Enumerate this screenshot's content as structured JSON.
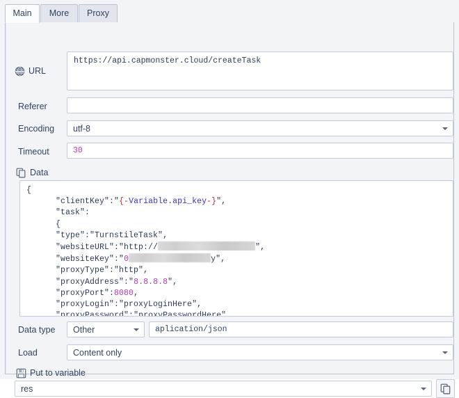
{
  "tabs": [
    {
      "label": "Main",
      "active": true
    },
    {
      "label": "More",
      "active": false
    },
    {
      "label": "Proxy",
      "active": false
    }
  ],
  "fields": {
    "url": {
      "label": "URL",
      "icon": "globe-www-icon",
      "value": "https://api.capmonster.cloud/createTask"
    },
    "referer": {
      "label": "Referer",
      "value": ""
    },
    "encoding": {
      "label": "Encoding",
      "value": "utf-8"
    },
    "timeout": {
      "label": "Timeout",
      "value": "30"
    },
    "data": {
      "label": "Data",
      "icon": "copy-icon",
      "lines": [
        "{",
        "     \"clientKey\":\"{-Variable.api_key-}\",",
        "     \"task\":",
        "     {",
        "     \"type\":\"TurnstileTask\",",
        "     \"websiteURL\":\"http://[redacted]\",",
        "     \"websiteKey\":\"0[redacted]y\",",
        "     \"proxyType\":\"http\",",
        "     \"proxyAddress\":\"8.8.8.8\",",
        "     \"proxyPort\":8080,",
        "     \"proxyLogin\":\"proxyLoginHere\",",
        "     \"proxyPassword\":\"proxyPasswordHere\"",
        "  }"
      ]
    },
    "data_type": {
      "label": "Data type",
      "value": "Other",
      "mime_value": "aplication/json"
    },
    "load": {
      "label": "Load",
      "value": "Content only"
    },
    "put_to_variable": {
      "label": "Put to variable",
      "icon": "save-floppy-icon",
      "value": "res",
      "copy_button_icon": "copy-icon"
    }
  },
  "colors": {
    "panel_bg": "#f2f4f8",
    "field_bg": "#ffffff",
    "border": "#c3cbd8",
    "text": "#33435e",
    "number_highlight": "#b23ab2",
    "brace_highlight": "#c42b2b",
    "variable_highlight": "#3434c8"
  }
}
